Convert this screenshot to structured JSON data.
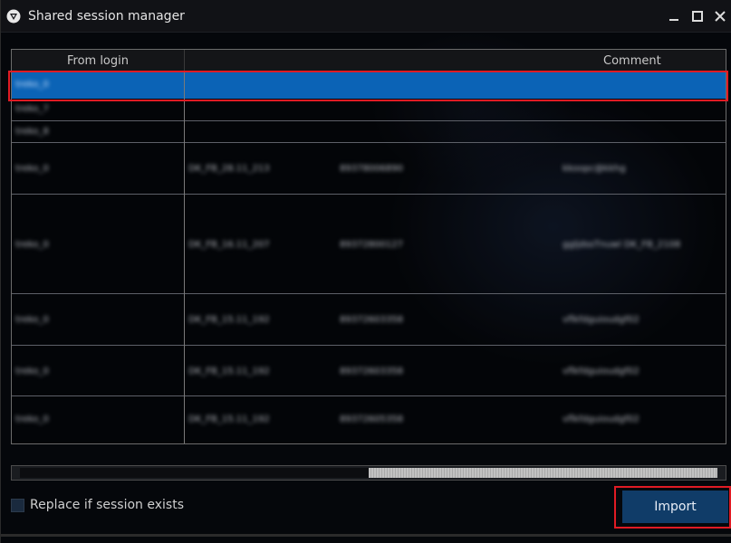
{
  "window": {
    "title": "Shared session manager",
    "icon": "app-logo-icon",
    "controls": [
      "minimize-icon",
      "maximize-icon",
      "close-icon"
    ]
  },
  "table": {
    "columns": [
      "From login",
      "Comment"
    ],
    "rows": [
      {
        "login": "treko_0",
        "selected": true
      },
      {
        "login": "treko_7"
      },
      {
        "login": "treko_8"
      },
      {
        "login": "treko_0",
        "c1": "DK_FB_28.11_213",
        "c2": "89378006890",
        "c3": "kkoopc@kkhg"
      },
      {
        "login": "treko_0",
        "c1": "DK_FB_16.11_207",
        "c2": "89372800127",
        "c3": "ggljdssTnuwl  DK_FB_2108"
      },
      {
        "login": "treko_0",
        "c1": "DK_FB_15.11_192",
        "c2": "89372603358",
        "c3": "vflkfdguioudgf02"
      },
      {
        "login": "treko_0",
        "c1": "DK_FB_15.11_192",
        "c2": "89372603358",
        "c3": "vflkfdguioudgf02"
      },
      {
        "login": "treko_0",
        "c1": "DK_FB_15.11_192",
        "c2": "89372605358",
        "c3": "vflkfdguioudgf02"
      }
    ]
  },
  "footer": {
    "checkbox_label": "Replace if session exists",
    "checkbox_checked": false,
    "import_label": "Import"
  },
  "colors": {
    "selection": "#0b63b6",
    "import_button": "#103c68",
    "highlight": "#e01b24"
  }
}
